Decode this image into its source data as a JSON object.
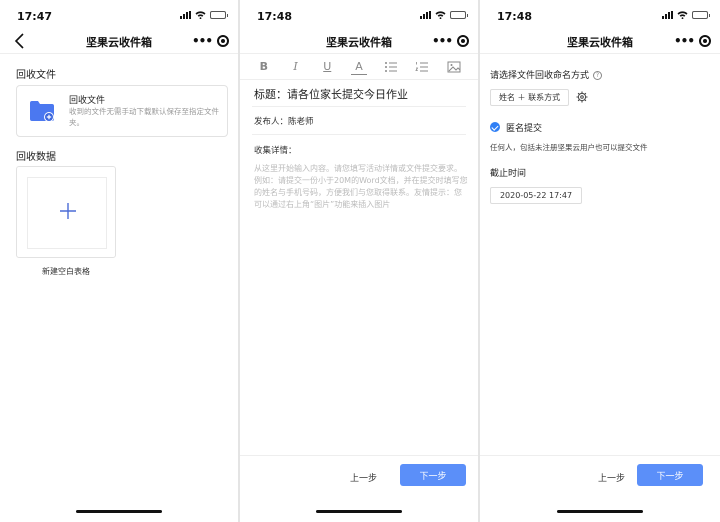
{
  "screens": [
    {
      "time": "17:47",
      "title": "坚果云收件箱",
      "recycle_files_label": "回收文件",
      "card": {
        "title": "回收文件",
        "desc": "收到的文件无需手动下载默认保存至指定文件夹。"
      },
      "recycle_data_label": "回收数据",
      "new_table_label": "新建空白表格"
    },
    {
      "time": "17:48",
      "toolbar": [
        "B",
        "I",
        "U",
        "A"
      ],
      "form_title": "标题：请各位家长提交今日作业",
      "publisher": "发布人：陈老师",
      "detail_label": "收集详情：",
      "placeholder": "从这里开始输入内容。请您填写活动详情或文件提交要求。例如：请提交一份小于20M的Word文档，并在提交时填写您的姓名与手机号码，方便我们与您取得联系。友情提示：您可以通过右上角“图片”功能来插入图片",
      "prev_label": "上一步",
      "next_label": "下一步"
    },
    {
      "time": "17:48",
      "title": "坚果云收件箱",
      "naming_label": "请选择文件回收命名方式",
      "help_icon": "?",
      "naming_value": "姓名 ＋ 联系方式",
      "anon_label": "匿名提交",
      "anon_desc": "任何人，包括未注册坚果云用户也可以提交文件",
      "deadline_label": "截止时间",
      "deadline_value": "2020-05-22 17:47",
      "prev_label": "上一步",
      "next_label": "下一步"
    }
  ],
  "colors": {
    "accent": "#5b8ff9",
    "folder": "#4b78f0",
    "check": "#2f7ff5",
    "plus": "#4b6bd6"
  },
  "icons": [
    "back-icon",
    "more-icon",
    "target-icon",
    "folder-plus-icon",
    "plus-icon",
    "gear-icon",
    "help-icon",
    "check-icon"
  ]
}
